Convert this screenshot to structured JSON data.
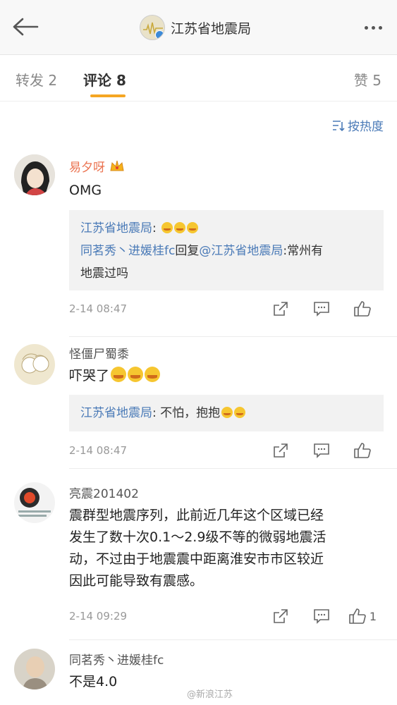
{
  "header": {
    "title": "江苏省地震局"
  },
  "tabs": [
    {
      "label": "转发 2"
    },
    {
      "label": "评论 8"
    },
    {
      "label": "赞 5"
    }
  ],
  "sort": {
    "label": "按热度"
  },
  "comments": [
    {
      "user": "易夕呀",
      "text": "OMG",
      "quote_name": "江苏省地震局",
      "quote_line2_users": "同茗秀丶进媛桂fc",
      "quote_line2_mid": "回复",
      "quote_line2_mention": "@江苏省地震局",
      "quote_line2_text": ":常州有",
      "quote_line3_text": "地震过吗",
      "time": "2-14 08:47"
    },
    {
      "user": "怪僵尸蜀黍",
      "text": "吓哭了",
      "quote_name": "江苏省地震局",
      "quote_text": ": 不怕，抱抱",
      "time": "2-14 08:47"
    },
    {
      "user": "亮震201402",
      "text_lines": [
        "震群型地震序列，此前近几年这个区域已经",
        "发生了数十次0.1～2.9级不等的微弱地震活",
        "动，不过由于地震震中距离淮安市市区较近",
        "因此可能导致有震感。"
      ],
      "time": "2-14 09:29",
      "likes": "1"
    },
    {
      "user": "同茗秀丶进媛桂fc",
      "text": "不是4.0"
    }
  ],
  "watermark": "@新浪江苏",
  "colors": {
    "accent": "#f5a623",
    "link": "#4a7ab7",
    "vip_name": "#eb7350"
  }
}
